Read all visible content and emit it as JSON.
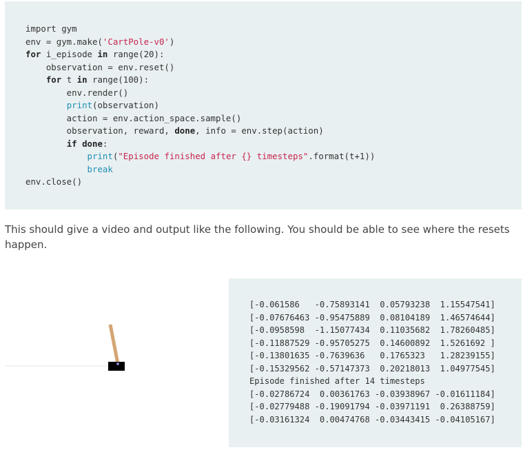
{
  "code": {
    "lines": [
      [
        {
          "t": "import gym",
          "c": ""
        }
      ],
      [
        {
          "t": "env = gym.make(",
          "c": ""
        },
        {
          "t": "'CartPole-v0'",
          "c": "str"
        },
        {
          "t": ")",
          "c": ""
        }
      ],
      [
        {
          "t": "for",
          "c": "kw"
        },
        {
          "t": " i_episode ",
          "c": ""
        },
        {
          "t": "in",
          "c": "kw"
        },
        {
          "t": " range(20):",
          "c": ""
        }
      ],
      [
        {
          "t": "    observation = env.reset()",
          "c": ""
        }
      ],
      [
        {
          "t": "    ",
          "c": ""
        },
        {
          "t": "for",
          "c": "kw"
        },
        {
          "t": " t ",
          "c": ""
        },
        {
          "t": "in",
          "c": "kw"
        },
        {
          "t": " range(100):",
          "c": ""
        }
      ],
      [
        {
          "t": "        env.render()",
          "c": ""
        }
      ],
      [
        {
          "t": "        ",
          "c": ""
        },
        {
          "t": "print",
          "c": "fn"
        },
        {
          "t": "(observation)",
          "c": ""
        }
      ],
      [
        {
          "t": "        action = env.action_space.sample()",
          "c": ""
        }
      ],
      [
        {
          "t": "        observation, reward, ",
          "c": ""
        },
        {
          "t": "done",
          "c": "kw"
        },
        {
          "t": ", info = env.step(action)",
          "c": ""
        }
      ],
      [
        {
          "t": "        ",
          "c": ""
        },
        {
          "t": "if",
          "c": "kw"
        },
        {
          "t": " ",
          "c": ""
        },
        {
          "t": "done",
          "c": "kw"
        },
        {
          "t": ":",
          "c": ""
        }
      ],
      [
        {
          "t": "            ",
          "c": ""
        },
        {
          "t": "print",
          "c": "fn"
        },
        {
          "t": "(",
          "c": ""
        },
        {
          "t": "\"Episode finished after {} timesteps\"",
          "c": "str"
        },
        {
          "t": ".format(t+1))",
          "c": ""
        }
      ],
      [
        {
          "t": "            ",
          "c": ""
        },
        {
          "t": "break",
          "c": "fn"
        }
      ],
      [
        {
          "t": "env.close()",
          "c": ""
        }
      ]
    ]
  },
  "prose": {
    "text": "This should give a video and output like the following. You should be able to see where the resets happen."
  },
  "output": {
    "lines": [
      "[-0.061586   -0.75893141  0.05793238  1.15547541]",
      "[-0.07676463 -0.95475889  0.08104189  1.46574644]",
      "[-0.0958598  -1.15077434  0.11035682  1.78260485]",
      "[-0.11887529 -0.95705275  0.14600892  1.5261692 ]",
      "[-0.13801635 -0.7639636   0.1765323   1.28239155]",
      "[-0.15329562 -0.57147373  0.20218013  1.04977545]",
      "Episode finished after 14 timesteps",
      "[-0.02786724  0.00361763 -0.03938967 -0.01611184]",
      "[-0.02779488 -0.19091794 -0.03971191  0.26388759]",
      "[-0.03161324  0.00474768 -0.03443415 -0.04105167]"
    ]
  },
  "colors": {
    "code_background": "#e9f0f2",
    "string": "#c7254e",
    "builtin": "#1f8fb5",
    "pole": "#d4a574",
    "cart": "#000000"
  }
}
